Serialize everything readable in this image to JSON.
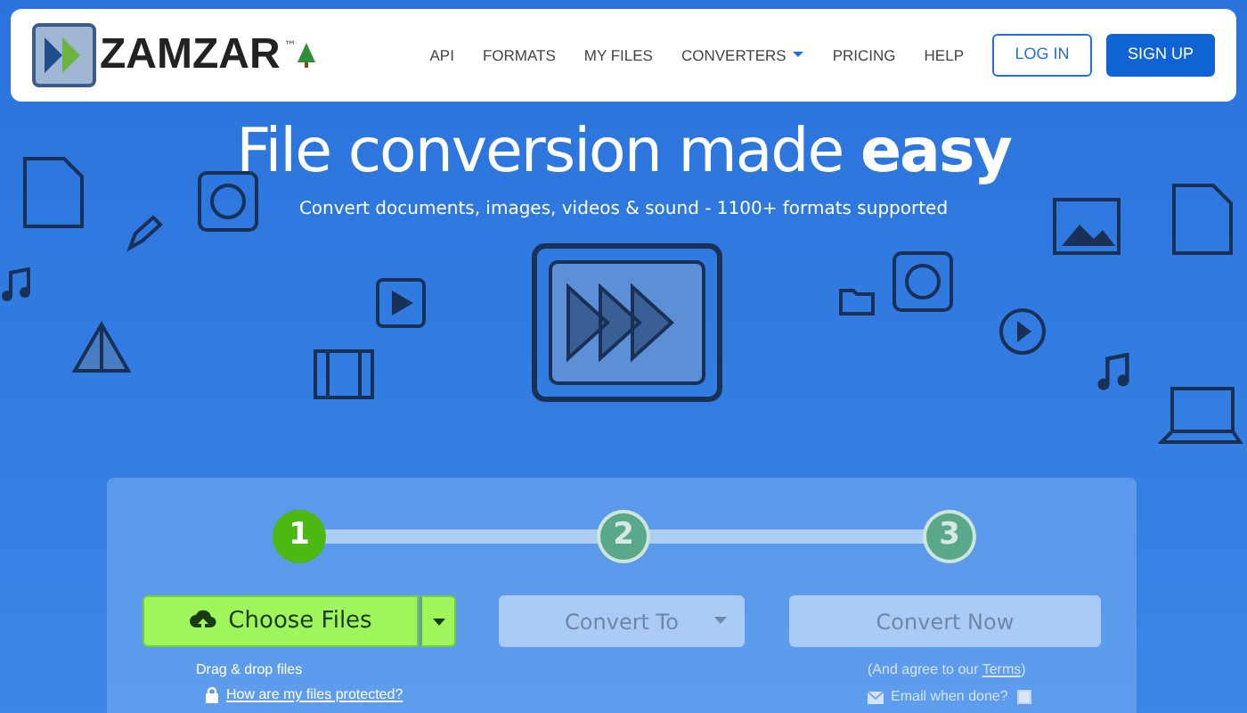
{
  "brand": {
    "name": "ZAMZAR",
    "tm": "™"
  },
  "nav": [
    {
      "label": "API",
      "dropdown": false
    },
    {
      "label": "FORMATS",
      "dropdown": false
    },
    {
      "label": "MY FILES",
      "dropdown": false
    },
    {
      "label": "CONVERTERS",
      "dropdown": true
    },
    {
      "label": "PRICING",
      "dropdown": false
    },
    {
      "label": "HELP",
      "dropdown": false
    }
  ],
  "auth": [
    {
      "label": "LOG IN",
      "kind": "outline"
    },
    {
      "label": "SIGN UP",
      "kind": "solid"
    }
  ],
  "hero": {
    "title": "File conversion made **easy**",
    "subtitle": "Convert documents, images, videos & sound - 1100+ formats supported"
  },
  "steps": [
    {
      "number": "1",
      "selected": true
    },
    {
      "number": "2",
      "selected": false
    },
    {
      "number": "3",
      "selected": false
    }
  ],
  "choose": {
    "label": "Choose Files",
    "hint": "Drag & drop files",
    "protect_link": "How are my files protected?"
  },
  "convert_to": {
    "label": "Convert To",
    "disabled": true
  },
  "convert_now": {
    "label": "Convert Now",
    "disabled": true,
    "agree_prefix": "(And agree to our ",
    "terms_link": "Terms",
    "agree_suffix": ")",
    "email_label": "Email when done?",
    "email_checked": false
  }
}
